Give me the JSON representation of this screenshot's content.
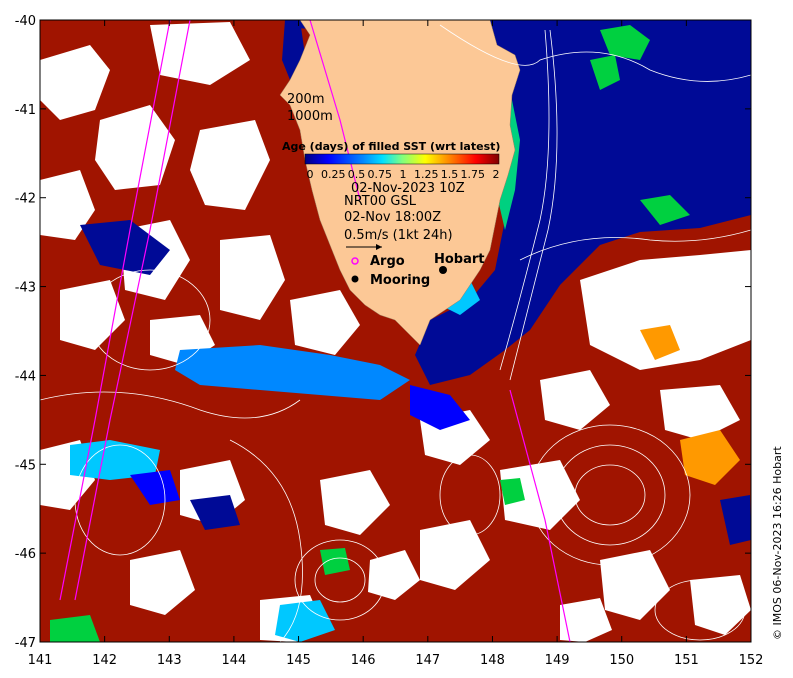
{
  "map": {
    "lon_range": [
      141,
      152
    ],
    "lat_range": [
      -47,
      -40
    ],
    "x_ticks": [
      "141",
      "142",
      "143",
      "144",
      "145",
      "146",
      "147",
      "148",
      "149",
      "150",
      "151",
      "152"
    ],
    "y_ticks": [
      "-40",
      "-41",
      "-42",
      "-43",
      "-44",
      "-45",
      "-46",
      "-47"
    ]
  },
  "bathymetry_labels": [
    "200m",
    "1000m"
  ],
  "colorbar": {
    "title": "Age (days) of filled SST (wrt latest)",
    "tick_labels": [
      "0",
      "0.25",
      "0.5",
      "0.75",
      "1",
      "1.25",
      "1.5",
      "1.75",
      "2"
    ],
    "colors": [
      "#00007f",
      "#0000ff",
      "#007fff",
      "#00ffff",
      "#7fff7f",
      "#ffff00",
      "#ff7f00",
      "#ff0000",
      "#7f0000"
    ]
  },
  "info": {
    "date": "02-Nov-2023 10Z",
    "currents_source": "NRT00 GSL",
    "currents_time": "02-Nov 18:00Z",
    "scale_label": "0.5m/s (1kt 24h)"
  },
  "legend": {
    "argo_label": "Argo",
    "mooring_label": "Mooring"
  },
  "places": {
    "hobart": "Hobart"
  },
  "credit": "© IMOS 06-Nov-2023 16:26 Hobart",
  "colors": {
    "land": "#fcc896",
    "ocean_deep": "#000a96",
    "sst_old": "#a01400",
    "argo": "#ff00ff",
    "track": "#ff00ff",
    "contour": "#ffffff"
  }
}
